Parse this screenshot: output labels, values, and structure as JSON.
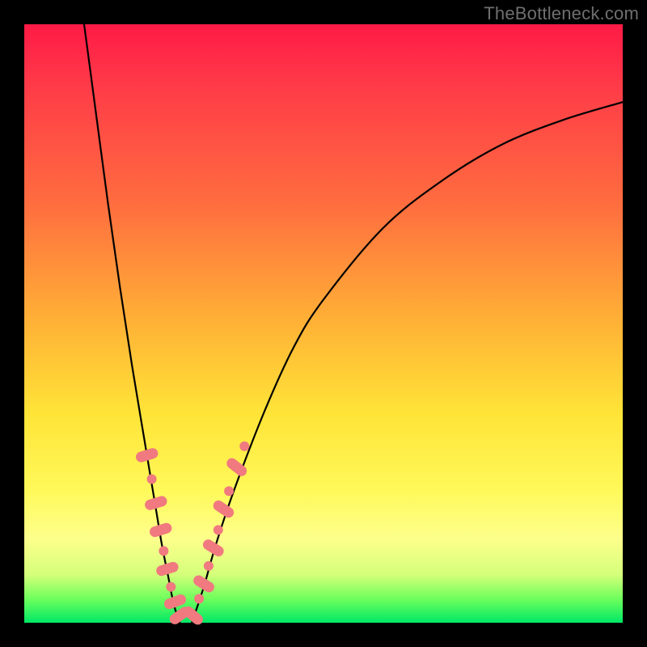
{
  "watermark": "TheBottleneck.com",
  "colors": {
    "bead": "#f07a7f",
    "curve": "#000000",
    "gradient_stops": [
      "#ff1a46",
      "#ff3a48",
      "#ff6d3f",
      "#ffb236",
      "#ffe437",
      "#fff95a",
      "#fdff8c",
      "#d4ff7a",
      "#6eff5c",
      "#00e865"
    ]
  },
  "chart_data": {
    "type": "line",
    "title": "",
    "xlabel": "",
    "ylabel": "",
    "xlim": [
      0,
      100
    ],
    "ylim": [
      0,
      100
    ],
    "grid": false,
    "legend": false,
    "series": [
      {
        "name": "left-curve",
        "x": [
          10,
          12,
          14,
          16,
          18,
          20,
          22,
          23,
          24,
          25,
          26
        ],
        "y": [
          100,
          85,
          70,
          56,
          43,
          31,
          19,
          13,
          8,
          3,
          0
        ]
      },
      {
        "name": "right-curve",
        "x": [
          28,
          30,
          32,
          35,
          40,
          45,
          50,
          60,
          70,
          80,
          90,
          100
        ],
        "y": [
          0,
          6,
          13,
          22,
          35,
          46,
          54,
          66,
          74,
          80,
          84,
          87
        ]
      }
    ],
    "annotations": {
      "beads_left": [
        {
          "x": 20.5,
          "y": 28,
          "shape": "pill",
          "angle": 73
        },
        {
          "x": 21.3,
          "y": 24,
          "shape": "dot"
        },
        {
          "x": 22.0,
          "y": 20,
          "shape": "pill",
          "angle": 73
        },
        {
          "x": 22.8,
          "y": 15.5,
          "shape": "pill",
          "angle": 73
        },
        {
          "x": 23.3,
          "y": 12,
          "shape": "dot"
        },
        {
          "x": 23.9,
          "y": 9,
          "shape": "pill",
          "angle": 73
        },
        {
          "x": 24.5,
          "y": 6,
          "shape": "dot"
        },
        {
          "x": 25.2,
          "y": 3.5,
          "shape": "pill",
          "angle": 70
        },
        {
          "x": 26.0,
          "y": 1.2,
          "shape": "pill",
          "angle": 55
        }
      ],
      "beads_right": [
        {
          "x": 28.2,
          "y": 1.2,
          "shape": "pill",
          "angle": -50
        },
        {
          "x": 29.2,
          "y": 4.0,
          "shape": "dot"
        },
        {
          "x": 30.0,
          "y": 6.5,
          "shape": "pill",
          "angle": -58
        },
        {
          "x": 30.8,
          "y": 9.5,
          "shape": "dot"
        },
        {
          "x": 31.6,
          "y": 12.5,
          "shape": "pill",
          "angle": -58
        },
        {
          "x": 32.4,
          "y": 15.5,
          "shape": "dot"
        },
        {
          "x": 33.3,
          "y": 19.0,
          "shape": "pill",
          "angle": -56
        },
        {
          "x": 34.2,
          "y": 22.0,
          "shape": "dot"
        },
        {
          "x": 35.5,
          "y": 26.0,
          "shape": "pill",
          "angle": -52
        },
        {
          "x": 36.8,
          "y": 29.5,
          "shape": "dot"
        }
      ],
      "valley_x_range": [
        25,
        29
      ]
    }
  }
}
